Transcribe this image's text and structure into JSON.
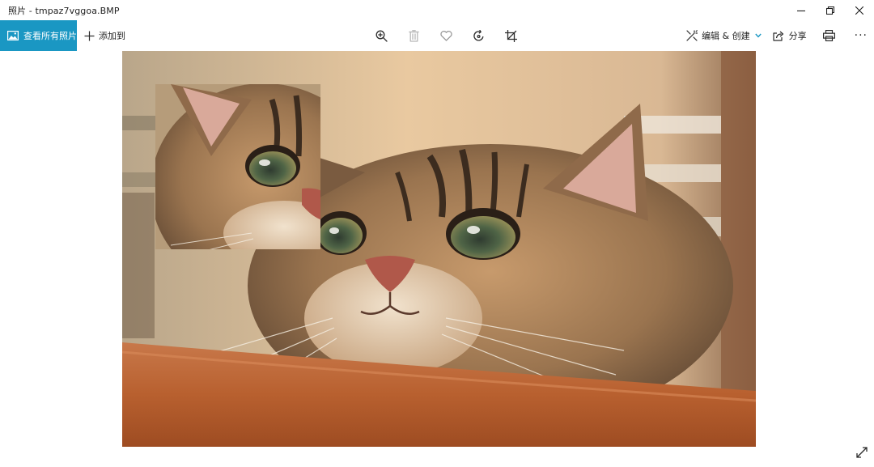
{
  "window": {
    "title": "照片 - tmpaz7vggoa.BMP"
  },
  "toolbar": {
    "view_all_label": "查看所有照片",
    "add_to_label": "添加到",
    "edit_create_label": "编辑 & 创建",
    "share_label": "分享",
    "more_label": "···",
    "accent_color": "#1a97c3"
  },
  "icons": {
    "view_all": "photo-gallery-icon",
    "add": "plus-icon",
    "zoom": "zoom-in-icon",
    "delete": "trash-icon",
    "favorite": "heart-icon",
    "rotate": "rotate-icon",
    "crop": "crop-icon",
    "edit": "edit-create-icon",
    "share": "share-icon",
    "print": "printer-icon",
    "fullscreen": "expand-icon"
  },
  "image": {
    "subject": "tabby cat resting chin on wooden table, with inset cropped copy"
  }
}
